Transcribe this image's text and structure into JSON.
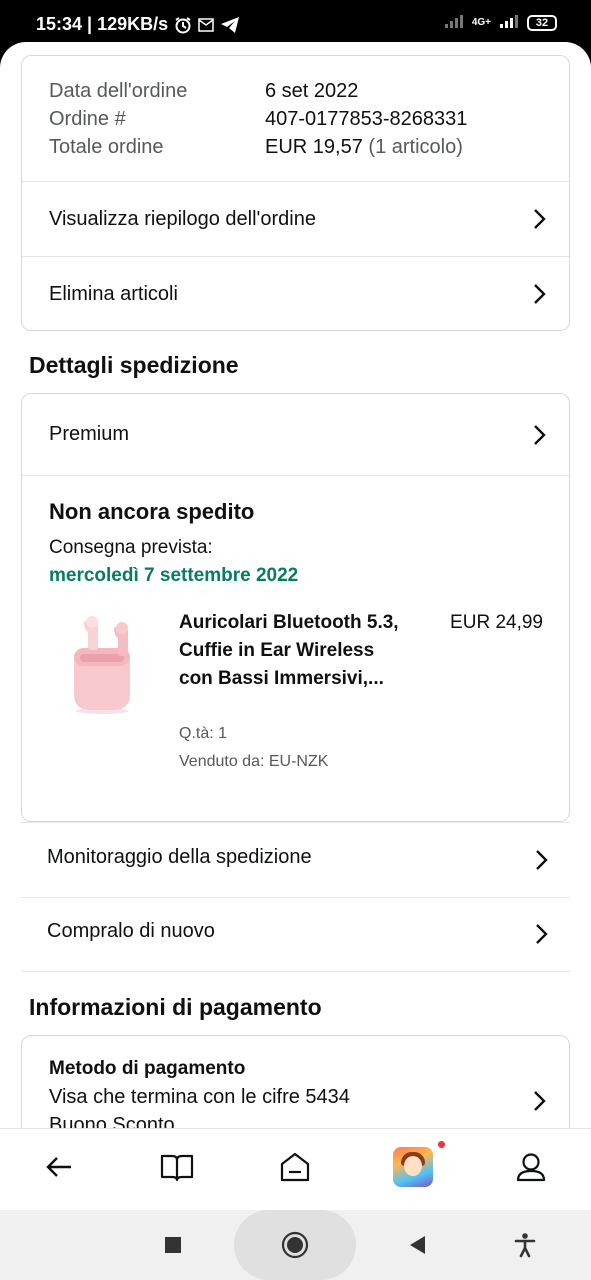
{
  "status_bar": {
    "time_speed": "15:34 | 129KB/s",
    "network": "4G+",
    "battery": "32"
  },
  "order_summary": {
    "rows": [
      {
        "label": "Data dell'ordine",
        "value": "6 set 2022",
        "extra": ""
      },
      {
        "label": "Ordine #",
        "value": "407-0177853-8268331",
        "extra": ""
      },
      {
        "label": "Totale ordine",
        "value": "EUR 19,57",
        "extra": "(1 articolo)"
      }
    ],
    "links": [
      "Visualizza riepilogo dell'ordine",
      "Elimina articoli"
    ]
  },
  "shipping": {
    "section_title": "Dettagli spedizione",
    "method": "Premium",
    "status": "Non ancora spedito",
    "eta_label": "Consegna prevista:",
    "eta_date": "mercoledì 7 settembre 2022",
    "product": {
      "title": "Auricolari Bluetooth 5.3, Cuffie in Ear Wireless con Bassi Immersivi,...",
      "price": "EUR 24,99",
      "qty": "Q.tà: 1",
      "seller": "Venduto da: EU-NZK"
    },
    "actions": [
      "Monitoraggio della spedizione",
      "Compralo di nuovo"
    ]
  },
  "payment": {
    "section_title": "Informazioni di pagamento",
    "method_title": "Metodo di pagamento",
    "line1": "Visa che termina con le cifre 5434",
    "line2": "Buono Sconto"
  },
  "bottom_nav": {
    "icons": [
      "back-arrow-icon",
      "book-icon",
      "home-icon",
      "game-app-icon",
      "profile-icon"
    ]
  },
  "colors": {
    "eta_green": "#067d62",
    "border": "#d5d9d9",
    "text": "#0f1111",
    "muted": "#565959"
  }
}
